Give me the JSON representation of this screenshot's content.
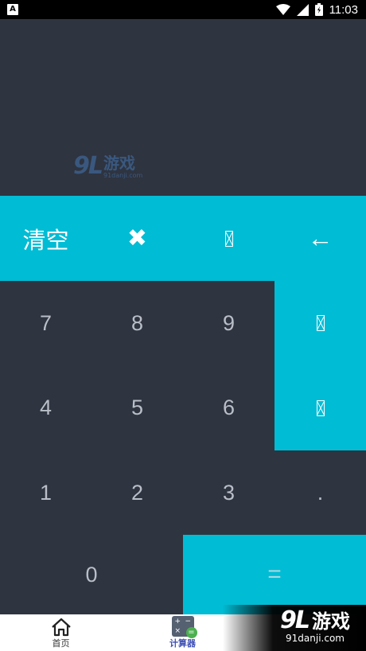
{
  "status_bar": {
    "time": "11:03",
    "notification_icon": "A"
  },
  "watermark": {
    "number": "9L",
    "text": "游戏",
    "url": "91danji.com"
  },
  "keys": {
    "clear": "清空",
    "multiply": "✖",
    "divide": "",
    "backspace": "←",
    "minus": "",
    "plus": "",
    "seven": "7",
    "eight": "8",
    "nine": "9",
    "four": "4",
    "five": "5",
    "six": "6",
    "one": "1",
    "two": "2",
    "three": "3",
    "dot": ".",
    "zero": "0",
    "equals": "="
  },
  "nav": {
    "home": "首页",
    "calculator": "计算器"
  },
  "corner_logo": {
    "number": "9L",
    "text": "游戏",
    "url": "91danji.com"
  },
  "colors": {
    "accent": "#00bcd4",
    "background": "#2e3440",
    "digit": "#b9bec7",
    "nav_active": "#3f51b5"
  }
}
